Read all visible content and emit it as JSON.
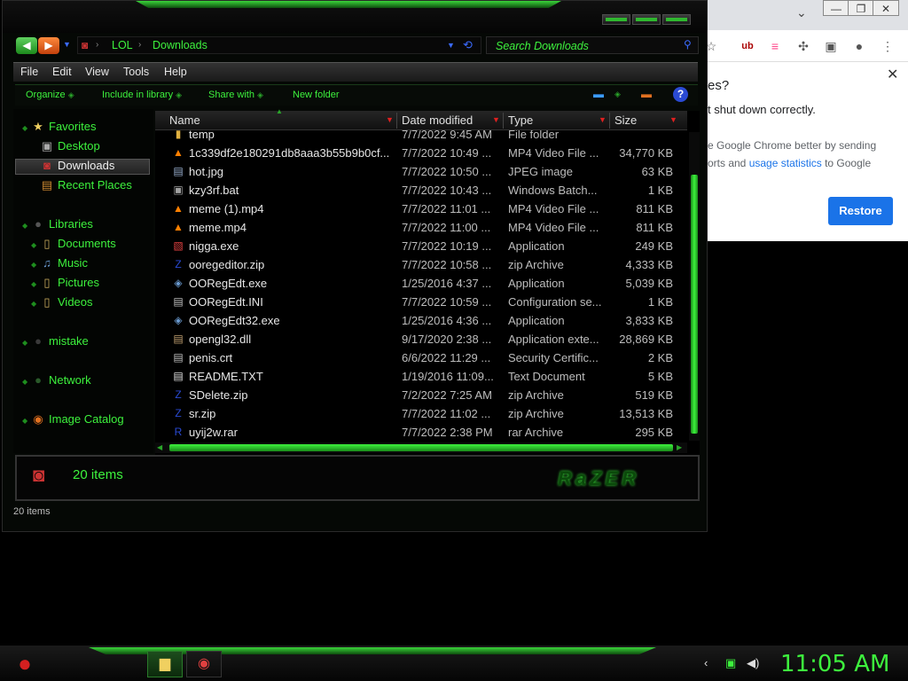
{
  "chrome": {
    "question_partial": "es?",
    "line1_partial": "t shut down correctly.",
    "line2_partial": "e Google Chrome better by sending",
    "line3_pre": "orts and ",
    "line3_link": "usage statistics",
    "line3_post": " to Google",
    "restore_label": "Restore",
    "close_glyph": "✕",
    "titlebar_buttons": [
      "—",
      "❐",
      "✕"
    ],
    "chevron": "⌄",
    "toolbar_icons": [
      "star-icon",
      "ublock-icon",
      "extension-colored-icon",
      "puzzle-icon",
      "sidepanel-icon",
      "profile-icon",
      "menu-dots-icon"
    ]
  },
  "explorer": {
    "breadcrumb": [
      "LOL",
      "Downloads"
    ],
    "search_placeholder": "Search Downloads",
    "menu": [
      "File",
      "Edit",
      "View",
      "Tools",
      "Help"
    ],
    "commands": [
      "Organize",
      "Include in library",
      "Share with",
      "New folder"
    ],
    "help_glyph": "?",
    "nav": {
      "favorites": "Favorites",
      "favorites_items": [
        "Desktop",
        "Downloads",
        "Recent Places"
      ],
      "selected": "Downloads",
      "libraries": "Libraries",
      "libraries_items": [
        "Documents",
        "Music",
        "Pictures",
        "Videos"
      ],
      "mistake": "mistake",
      "network": "Network",
      "image_catalog": "Image Catalog"
    },
    "columns": [
      "Name",
      "Date modified",
      "Type",
      "Size"
    ],
    "files": [
      {
        "icon": "folder-icon",
        "name": "temp",
        "date": "7/7/2022 9:45 AM",
        "type": "File folder",
        "size": ""
      },
      {
        "icon": "vlc-icon",
        "name": "1c339df2e180291db8aaa3b55b9b0cf...",
        "date": "7/7/2022 10:49 ...",
        "type": "MP4 Video File ...",
        "size": "34,770 KB"
      },
      {
        "icon": "image-icon",
        "name": "hot.jpg",
        "date": "7/7/2022 10:50 ...",
        "type": "JPEG image",
        "size": "63 KB"
      },
      {
        "icon": "batch-icon",
        "name": "kzy3rf.bat",
        "date": "7/7/2022 10:43 ...",
        "type": "Windows Batch...",
        "size": "1 KB"
      },
      {
        "icon": "vlc-icon",
        "name": "meme (1).mp4",
        "date": "7/7/2022 11:01 ...",
        "type": "MP4 Video File ...",
        "size": "811 KB"
      },
      {
        "icon": "vlc-icon",
        "name": "meme.mp4",
        "date": "7/7/2022 11:00 ...",
        "type": "MP4 Video File ...",
        "size": "811 KB"
      },
      {
        "icon": "exe-icon",
        "name": "nigga.exe",
        "date": "7/7/2022 10:19 ...",
        "type": "Application",
        "size": "249 KB"
      },
      {
        "icon": "zip-icon",
        "name": "ooregeditor.zip",
        "date": "7/7/2022 10:58 ...",
        "type": "zip Archive",
        "size": "4,333 KB"
      },
      {
        "icon": "app-icon",
        "name": "OORegEdt.exe",
        "date": "1/25/2016 4:37 ...",
        "type": "Application",
        "size": "5,039 KB"
      },
      {
        "icon": "config-icon",
        "name": "OORegEdt.INI",
        "date": "7/7/2022 10:59 ...",
        "type": "Configuration se...",
        "size": "1 KB"
      },
      {
        "icon": "app-icon",
        "name": "OORegEdt32.exe",
        "date": "1/25/2016 4:36 ...",
        "type": "Application",
        "size": "3,833 KB"
      },
      {
        "icon": "dll-icon",
        "name": "opengl32.dll",
        "date": "9/17/2020 2:38 ...",
        "type": "Application exte...",
        "size": "28,869 KB"
      },
      {
        "icon": "cert-icon",
        "name": "penis.crt",
        "date": "6/6/2022 11:29 ...",
        "type": "Security Certific...",
        "size": "2 KB"
      },
      {
        "icon": "text-icon",
        "name": "README.TXT",
        "date": "1/19/2016 11:09...",
        "type": "Text Document",
        "size": "5 KB"
      },
      {
        "icon": "zip-icon",
        "name": "SDelete.zip",
        "date": "7/2/2022 7:25 AM",
        "type": "zip Archive",
        "size": "519 KB"
      },
      {
        "icon": "zip-icon",
        "name": "sr.zip",
        "date": "7/7/2022 11:02 ...",
        "type": "zip Archive",
        "size": "13,513 KB"
      },
      {
        "icon": "rar-icon",
        "name": "uyij2w.rar",
        "date": "7/7/2022 2:38 PM",
        "type": "rar Archive",
        "size": "295 KB"
      }
    ],
    "details_count": "20 items",
    "status_count": "20 items",
    "logo_text": "RaZER"
  },
  "taskbar": {
    "clock": "11:05 AM",
    "tasks": [
      "explorer-task",
      "chrome-task"
    ]
  },
  "colors": {
    "accent": "#3df23d",
    "background": "#000000",
    "chrome_blue": "#1a73e8"
  }
}
